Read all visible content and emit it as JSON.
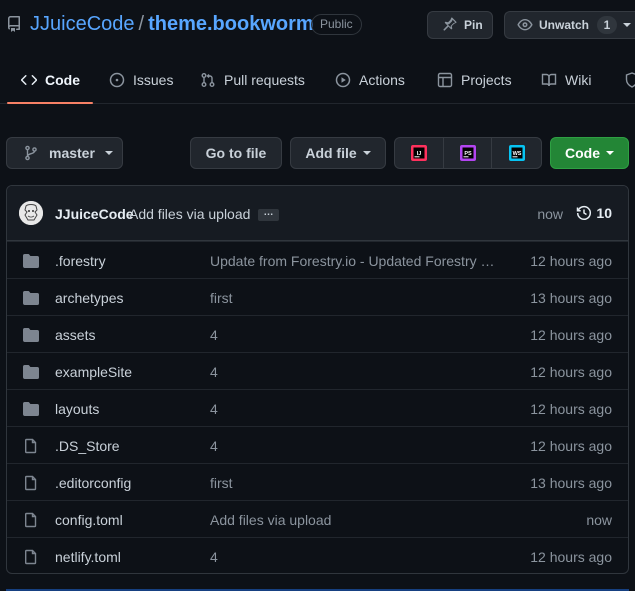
{
  "repo": {
    "owner": "JJuiceCode",
    "separator": "/",
    "name": "theme.bookworm",
    "visibility": "Public"
  },
  "header_actions": {
    "pin_label": "Pin",
    "watch_label": "Unwatch",
    "watch_count": "1"
  },
  "tabs": [
    {
      "label": "Code",
      "icon": "code-icon",
      "selected": true
    },
    {
      "label": "Issues",
      "icon": "issue-opened-icon"
    },
    {
      "label": "Pull requests",
      "icon": "git-pull-request-icon"
    },
    {
      "label": "Actions",
      "icon": "play-icon"
    },
    {
      "label": "Projects",
      "icon": "table-icon"
    },
    {
      "label": "Wiki",
      "icon": "book-icon"
    }
  ],
  "toolbar": {
    "branch": "master",
    "goto_file": "Go to file",
    "add_file": "Add file",
    "code": "Code",
    "ide_buttons": [
      {
        "icon": "intellij-idea-icon",
        "label": "IJ",
        "color": "#fe315d"
      },
      {
        "icon": "phpstorm-icon",
        "label": "PS",
        "color": "#b345f1"
      },
      {
        "icon": "webstorm-icon",
        "label": "WS",
        "color": "#07c3f2"
      }
    ]
  },
  "latest_commit": {
    "author": "JJuiceCode",
    "message": "Add files via upload",
    "ellipsis": "…",
    "time": "now",
    "commit_count": "10"
  },
  "files": [
    {
      "name": ".forestry",
      "type": "folder",
      "commit": "Update from Forestry.io - Updated Forestry …",
      "age": "12 hours ago"
    },
    {
      "name": "archetypes",
      "type": "folder",
      "commit": "first",
      "age": "13 hours ago"
    },
    {
      "name": "assets",
      "type": "folder",
      "commit": "4",
      "age": "12 hours ago"
    },
    {
      "name": "exampleSite",
      "type": "folder",
      "commit": "4",
      "age": "12 hours ago"
    },
    {
      "name": "layouts",
      "type": "folder",
      "commit": "4",
      "age": "12 hours ago"
    },
    {
      "name": ".DS_Store",
      "type": "file",
      "commit": "4",
      "age": "12 hours ago"
    },
    {
      "name": ".editorconfig",
      "type": "file",
      "commit": "first",
      "age": "13 hours ago"
    },
    {
      "name": "config.toml",
      "type": "file",
      "commit": "Add files via upload",
      "age": "now"
    },
    {
      "name": "netlify.toml",
      "type": "file",
      "commit": "4",
      "age": "12 hours ago"
    }
  ],
  "colors": {
    "background": "#0d1117",
    "link": "#58a6ff",
    "tab_underline": "#f78166",
    "code_button": "#238636",
    "folder_icon": "#7d8590"
  }
}
